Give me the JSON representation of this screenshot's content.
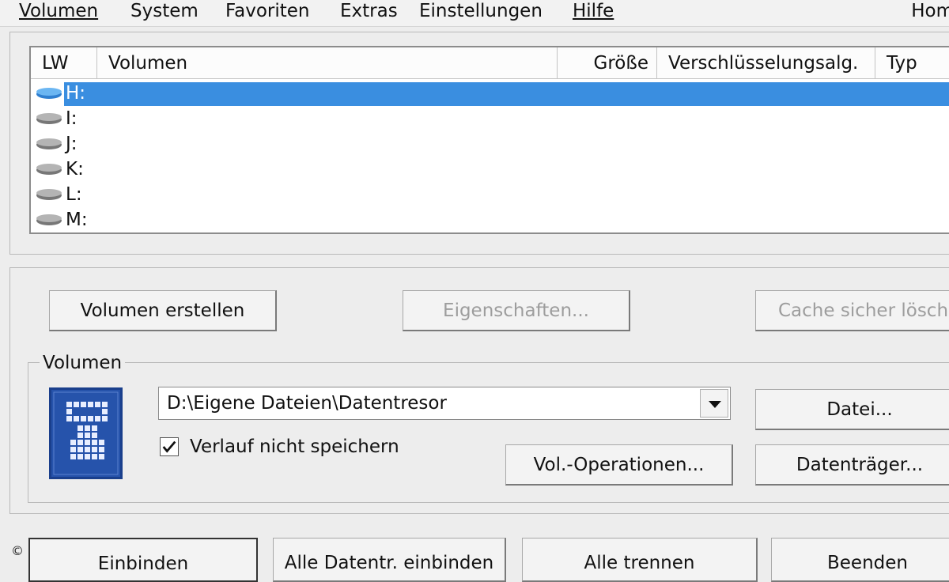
{
  "menubar": {
    "items": [
      {
        "label": "Volumen"
      },
      {
        "label": "System"
      },
      {
        "label": "Favoriten"
      },
      {
        "label": "Extras"
      },
      {
        "label": "Einstellungen"
      },
      {
        "label": "Hilfe"
      }
    ],
    "right_label": "Hom"
  },
  "drive_list": {
    "columns": [
      "LW",
      "Volumen",
      "Größe",
      "Verschlüsselungsalg.",
      "Typ"
    ],
    "rows": [
      {
        "drive": "H:",
        "selected": true
      },
      {
        "drive": "I:",
        "selected": false
      },
      {
        "drive": "J:",
        "selected": false
      },
      {
        "drive": "K:",
        "selected": false
      },
      {
        "drive": "L:",
        "selected": false
      },
      {
        "drive": "M:",
        "selected": false
      }
    ]
  },
  "buttons": {
    "create_volume": "Volumen erstellen",
    "properties": "Eigenschaften...",
    "wipe_cache": "Cache sicher lösche",
    "file": "Datei...",
    "vol_operations": "Vol.-Operationen...",
    "device": "Datenträger...",
    "mount": "Einbinden",
    "mount_all": "Alle Datentr. einbinden",
    "dismount_all": "Alle trennen",
    "exit": "Beenden"
  },
  "volume_group": {
    "label": "Volumen",
    "path": "D:\\Eigene Dateien\\Datentresor",
    "never_save_history_label": "Verlauf nicht speichern",
    "never_save_history_checked": true
  },
  "footer": {
    "copyright": "©"
  },
  "colors": {
    "selection": "#3a8ee0",
    "logo_blue": "#1f4fa6",
    "drive_selected": "#4f9fe6",
    "drive_gray": "#9a9a9a"
  }
}
